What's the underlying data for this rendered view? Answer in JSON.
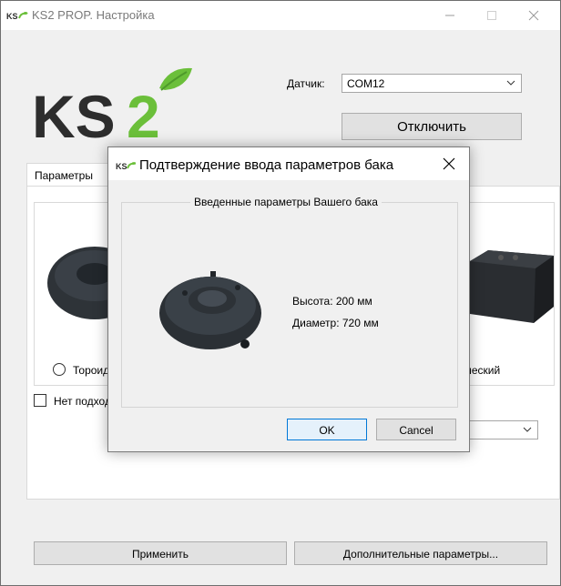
{
  "window": {
    "title": "KS2 PROP. Настройка",
    "icon": "ks2-app-icon",
    "logo_text": "KS2"
  },
  "connection": {
    "sensor_label": "Датчик:",
    "port_value": "COM12",
    "disconnect_button": "Отключить"
  },
  "tabs": [
    {
      "label": "Параметры"
    }
  ],
  "tank_types": {
    "toroidal_label": "Тороид",
    "cubic_label": "бический"
  },
  "options": {
    "no_checkbox_label": "Нет подход"
  },
  "footer": {
    "apply_button": "Применить",
    "advanced_button": "Дополнительные параметры..."
  },
  "dialog": {
    "title": "Подтверждение ввода параметров бака",
    "group_label": "Введенные параметры Вашего бака",
    "height_text": "Высота: 200 мм",
    "diameter_text": "Диаметр: 720 мм",
    "ok_button": "OK",
    "cancel_button": "Cancel"
  },
  "colors": {
    "brand_green": "#6bbf3a",
    "logo_dark": "#2d2d2d",
    "focus_blue": "#0078d7"
  }
}
